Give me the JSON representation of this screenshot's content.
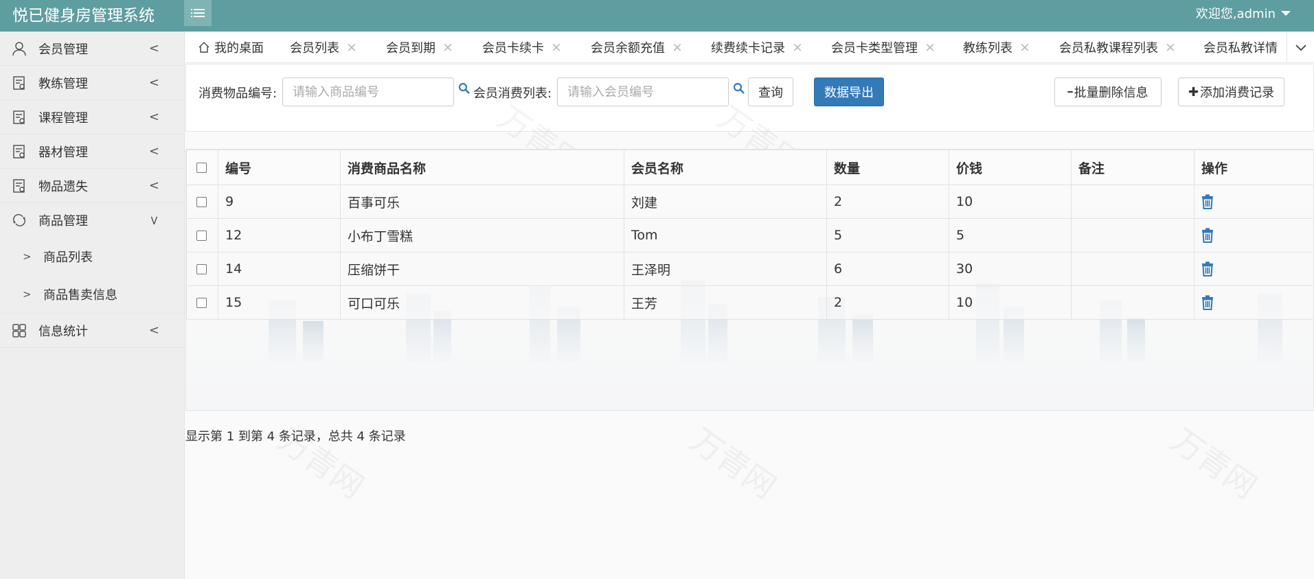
{
  "app": {
    "title": "悦已健身房管理系统",
    "welcome": "欢迎您,admin"
  },
  "sidebar": {
    "items": [
      {
        "label": "会员管理",
        "icon": "user-icon",
        "arrow": "<"
      },
      {
        "label": "教练管理",
        "icon": "document-icon",
        "arrow": "<"
      },
      {
        "label": "课程管理",
        "icon": "document-icon",
        "arrow": "<"
      },
      {
        "label": "器材管理",
        "icon": "document-icon",
        "arrow": "<"
      },
      {
        "label": "物品遗失",
        "icon": "document-icon",
        "arrow": "<"
      },
      {
        "label": "商品管理",
        "icon": "refresh-icon",
        "arrow": "<"
      }
    ],
    "sub_items": [
      {
        "label": "商品列表",
        "arrow": ">"
      },
      {
        "label": "商品售卖信息",
        "arrow": ">"
      }
    ],
    "last_item": {
      "label": "信息统计",
      "icon": "grid-icon",
      "arrow": "<"
    }
  },
  "tabs": {
    "home": "我的桌面",
    "close": "×",
    "items": [
      "会员列表",
      "会员到期",
      "会员卡续卡",
      "会员余额充值",
      "续费续卡记录",
      "会员卡类型管理",
      "教练列表",
      "会员私教课程列表",
      "会员私教详情"
    ]
  },
  "toolbar": {
    "goods_label": "消费物品编号:",
    "goods_placeholder": "请输入商品编号",
    "member_label": "会员消费列表:",
    "member_placeholder": "请输入会员编号",
    "query_label": "查询",
    "export_label": "数据导出",
    "batch_delete_label": "批量删除信息",
    "add_label": "添加消费记录",
    "minus_glyph": "━",
    "plus_glyph": "✚"
  },
  "table": {
    "headers": [
      "编号",
      "消费商品名称",
      "会员名称",
      "数量",
      "价钱",
      "备注",
      "操作"
    ],
    "rows": [
      [
        "9",
        "百事可乐",
        "刘建",
        "2",
        "10",
        ""
      ],
      [
        "12",
        "小布丁雪糕",
        "Tom",
        "5",
        "5",
        ""
      ],
      [
        "14",
        "压缩饼干",
        "王泽明",
        "6",
        "30",
        ""
      ],
      [
        "15",
        "可口可乐",
        "王芳",
        "2",
        "10",
        ""
      ]
    ]
  },
  "pagination": {
    "info": "显示第 1 到第 4 条记录，总共 4 条记录"
  },
  "colors": {
    "header_bg": "#5f9ea0",
    "primary_button": "#337ab7",
    "trash_icon": "#337ab7"
  }
}
